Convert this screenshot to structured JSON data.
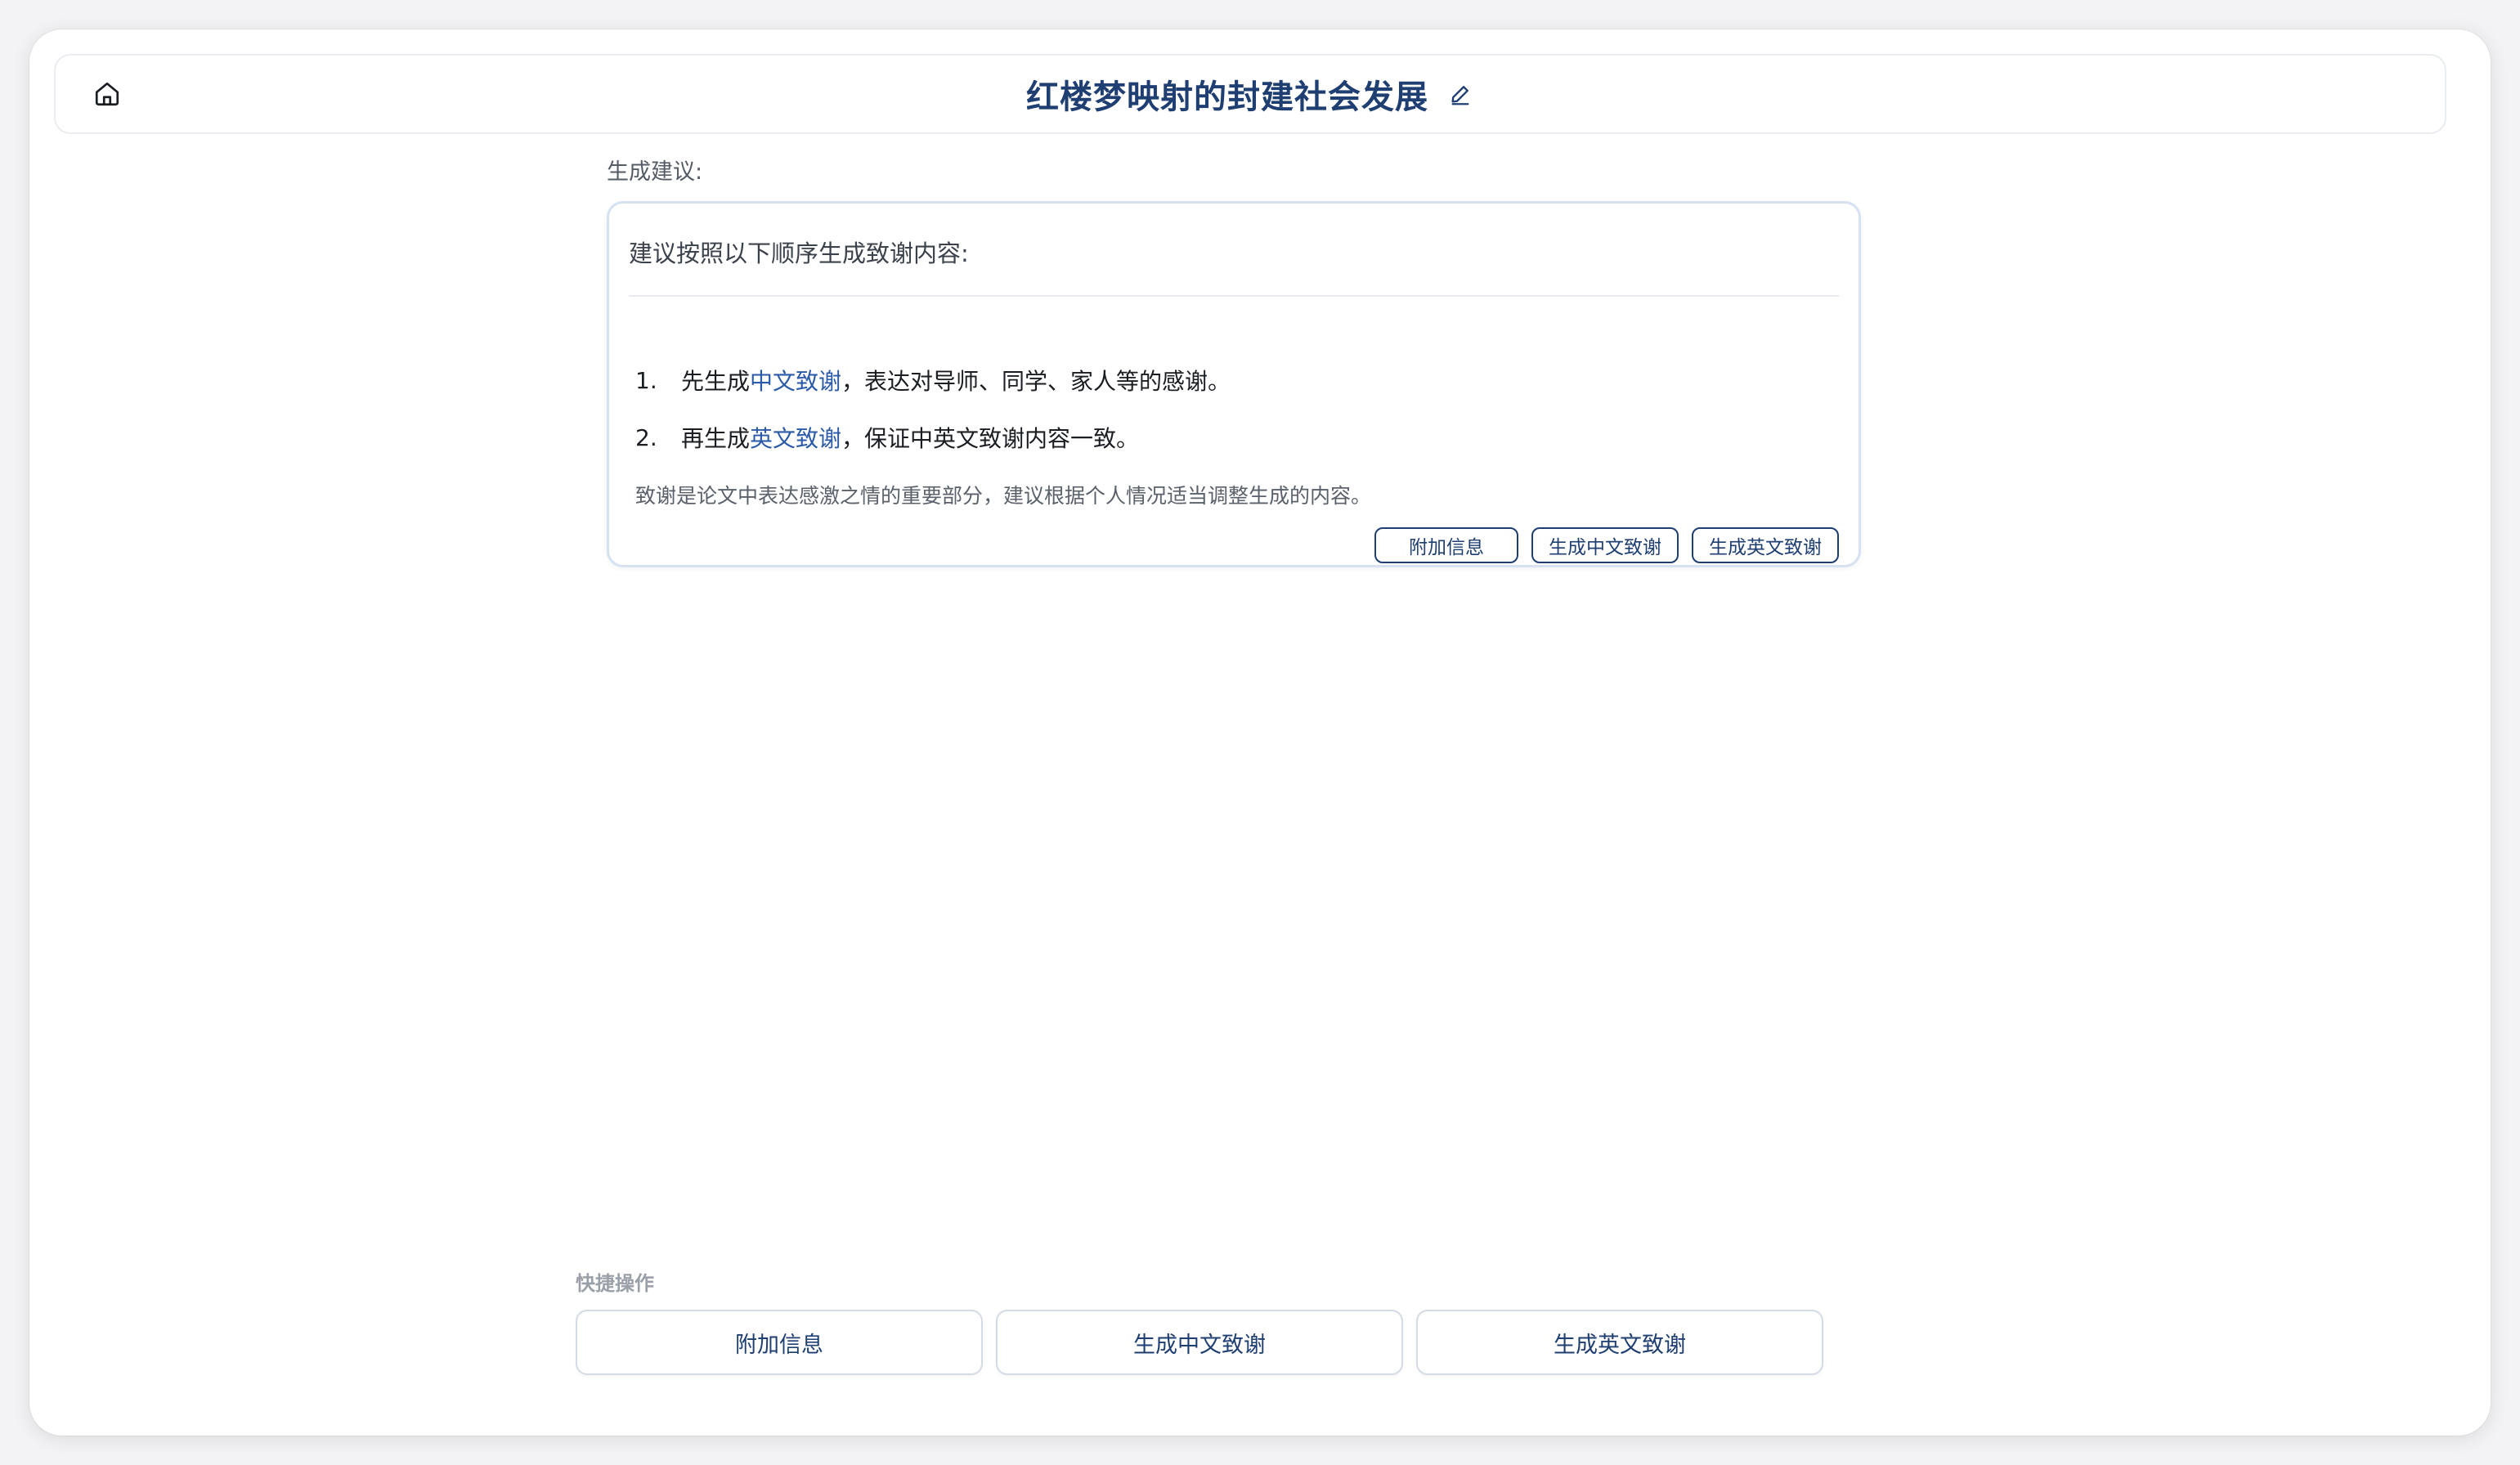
{
  "header": {
    "title": "红楼梦映射的封建社会发展",
    "home_icon": "home-icon",
    "edit_icon": "pencil-icon"
  },
  "suggestion": {
    "label": "生成建议:",
    "heading": "建议按照以下顺序生成致谢内容:",
    "steps": [
      {
        "num": "1.",
        "prefix": "先生成",
        "highlight": "中文致谢",
        "suffix": "，表达对导师、同学、家人等的感谢。"
      },
      {
        "num": "2.",
        "prefix": "再生成",
        "highlight": "英文致谢",
        "suffix": "，保证中英文致谢内容一致。"
      }
    ],
    "note": "致谢是论文中表达感激之情的重要部分，建议根据个人情况适当调整生成的内容。",
    "buttons": [
      "附加信息",
      "生成中文致谢",
      "生成英文致谢"
    ]
  },
  "quick_actions": {
    "label": "快捷操作",
    "buttons": [
      "附加信息",
      "生成中文致谢",
      "生成英文致谢"
    ]
  },
  "colors": {
    "primary": "#1f3f72",
    "highlight": "#2a5aa8",
    "card_border": "#d6e2f1"
  }
}
